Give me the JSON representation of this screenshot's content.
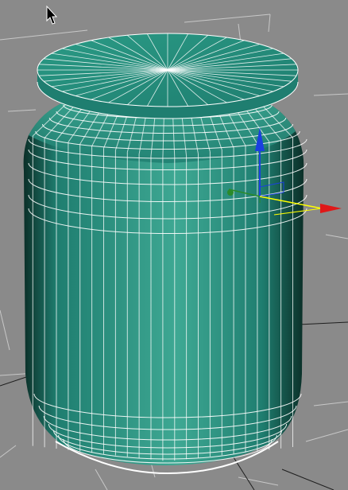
{
  "viewport": {
    "background_color": "#8a8a8a",
    "grid_line_color": "#c8c8c8",
    "grid_dark_line_color": "#1e1e1e",
    "cursor_icon": "arrow-cursor-icon"
  },
  "object": {
    "kind": "cylinder-jar",
    "display_mode": "smooth-highlights-edged-faces",
    "base_color": "#1f7e70",
    "light_color": "#3ea893",
    "dark_color": "#0b2f28",
    "wire_color": "#ffffff",
    "lid_color": "#2a9a85"
  },
  "gizmo": {
    "type": "move-transform",
    "x_axis_color": "#e01818",
    "y_axis_color": "#2a8a2a",
    "z_axis_color": "#1a3fe0",
    "plane_color": "#ffff00"
  }
}
